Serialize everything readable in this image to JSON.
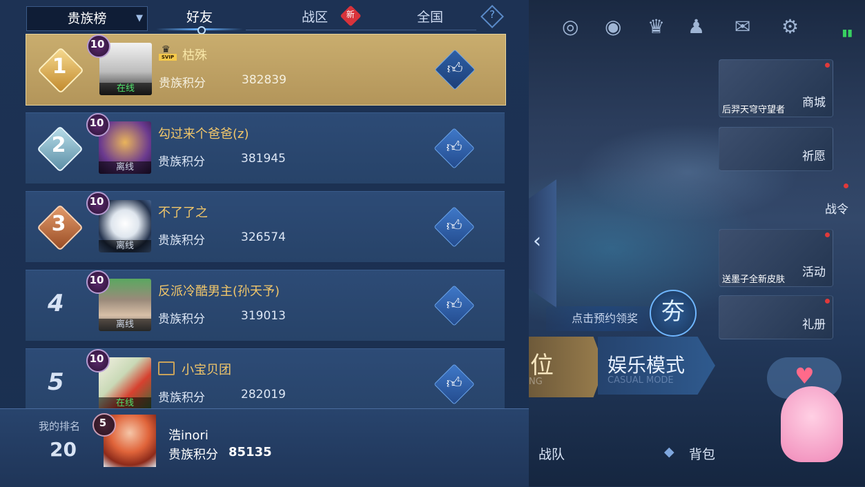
{
  "header": {
    "dropdown_label": "贵族榜",
    "tabs": [
      {
        "label": "好友",
        "active": true
      },
      {
        "label": "战区",
        "badge": "新"
      },
      {
        "label": "全国"
      }
    ],
    "help_symbol": "?"
  },
  "score_label": "贵族积分",
  "rows": [
    {
      "rank": "1",
      "level": "10",
      "name": "枯殊",
      "score": "382839",
      "status": "在线",
      "svip": "SVIP"
    },
    {
      "rank": "2",
      "level": "10",
      "name": "勾过来个爸爸(z)",
      "score": "381945",
      "status": "离线"
    },
    {
      "rank": "3",
      "level": "10",
      "name": "不了了之",
      "score": "326574",
      "status": "离线"
    },
    {
      "rank": "4",
      "level": "10",
      "name": "反派冷酷男主(孙天予)",
      "score": "319013",
      "status": "离线"
    },
    {
      "rank": "5",
      "level": "10",
      "name": "小宝贝团",
      "score": "282019",
      "status": "在线"
    }
  ],
  "my_rank": {
    "label": "我的排名",
    "rank": "20",
    "level": "5",
    "name": "浩inori",
    "score_label": "贵族积分",
    "score": "85135"
  },
  "scene": {
    "side_buttons": [
      {
        "label": "商城",
        "caption": "后羿天穹守望者"
      },
      {
        "label": "祈愿"
      },
      {
        "label": "战令"
      },
      {
        "label": "活动",
        "caption": "送墨子全新皮肤"
      },
      {
        "label": "礼册"
      }
    ],
    "reserve_text": "点击预约领奖",
    "badge_glyph": "夯",
    "mode_ranked_title": "位",
    "mode_ranked_sub": "NG",
    "mode_casual_title": "娱乐模式",
    "mode_casual_sub": "CASUAL MODE",
    "bottom_nav": [
      "战队",
      "背包"
    ]
  },
  "colors": {
    "panel_bg": "#1d3254",
    "first_row_gold": "#c9ad6e",
    "name_gold": "#f2c76a",
    "online_green": "#4fe06a",
    "badge_red": "#d8333b"
  }
}
